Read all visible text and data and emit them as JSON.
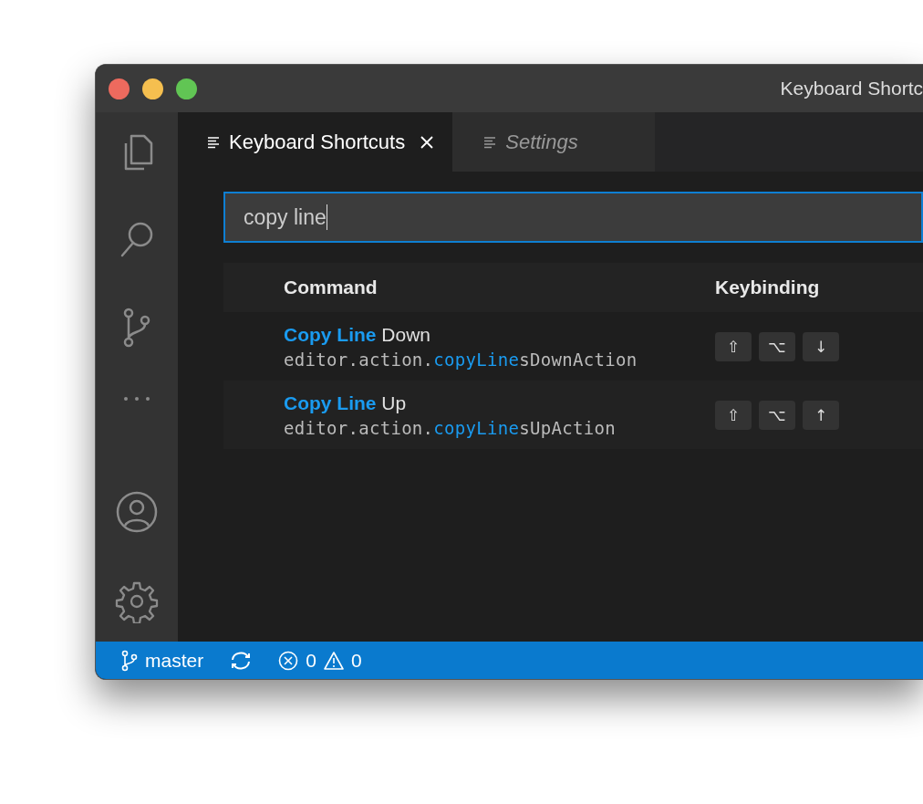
{
  "window": {
    "title": "Keyboard Shortc",
    "traffic_lights": [
      {
        "color": "#ed6a5e"
      },
      {
        "color": "#f5bf4f"
      },
      {
        "color": "#61c554"
      }
    ]
  },
  "activity_bar": {
    "items": [
      {
        "kind": "files",
        "selected": false
      },
      {
        "kind": "search",
        "selected": false
      },
      {
        "kind": "source-control",
        "selected": false
      },
      {
        "kind": "more",
        "selected": false
      }
    ],
    "bottom_items": [
      {
        "kind": "account"
      },
      {
        "kind": "settings"
      }
    ]
  },
  "tabs": [
    {
      "label": "Keyboard Shortcuts",
      "selected": true,
      "closable": true
    },
    {
      "label": "Settings",
      "selected": false,
      "closable": false
    }
  ],
  "search": {
    "value": "copy line",
    "focused": true
  },
  "table": {
    "columns": [
      "Command",
      "Keybinding"
    ],
    "rows": [
      {
        "title": [
          {
            "text": "Copy Line",
            "match": true
          },
          {
            "text": " Down",
            "match": false
          }
        ],
        "command_id": [
          {
            "text": "editor.action.",
            "match": false
          },
          {
            "text": "copyLine",
            "match": true
          },
          {
            "text": "sDownAction",
            "match": false
          }
        ],
        "keys": [
          "⇧",
          "⌥",
          "↓"
        ]
      },
      {
        "title": [
          {
            "text": "Copy Line",
            "match": true
          },
          {
            "text": " Up",
            "match": false
          }
        ],
        "command_id": [
          {
            "text": "editor.action.",
            "match": false
          },
          {
            "text": "copyLine",
            "match": true
          },
          {
            "text": "sUpAction",
            "match": false
          }
        ],
        "keys": [
          "⇧",
          "⌥",
          "↑"
        ]
      }
    ]
  },
  "status_bar": {
    "branch": "master",
    "errors": "0",
    "warnings": "0"
  }
}
